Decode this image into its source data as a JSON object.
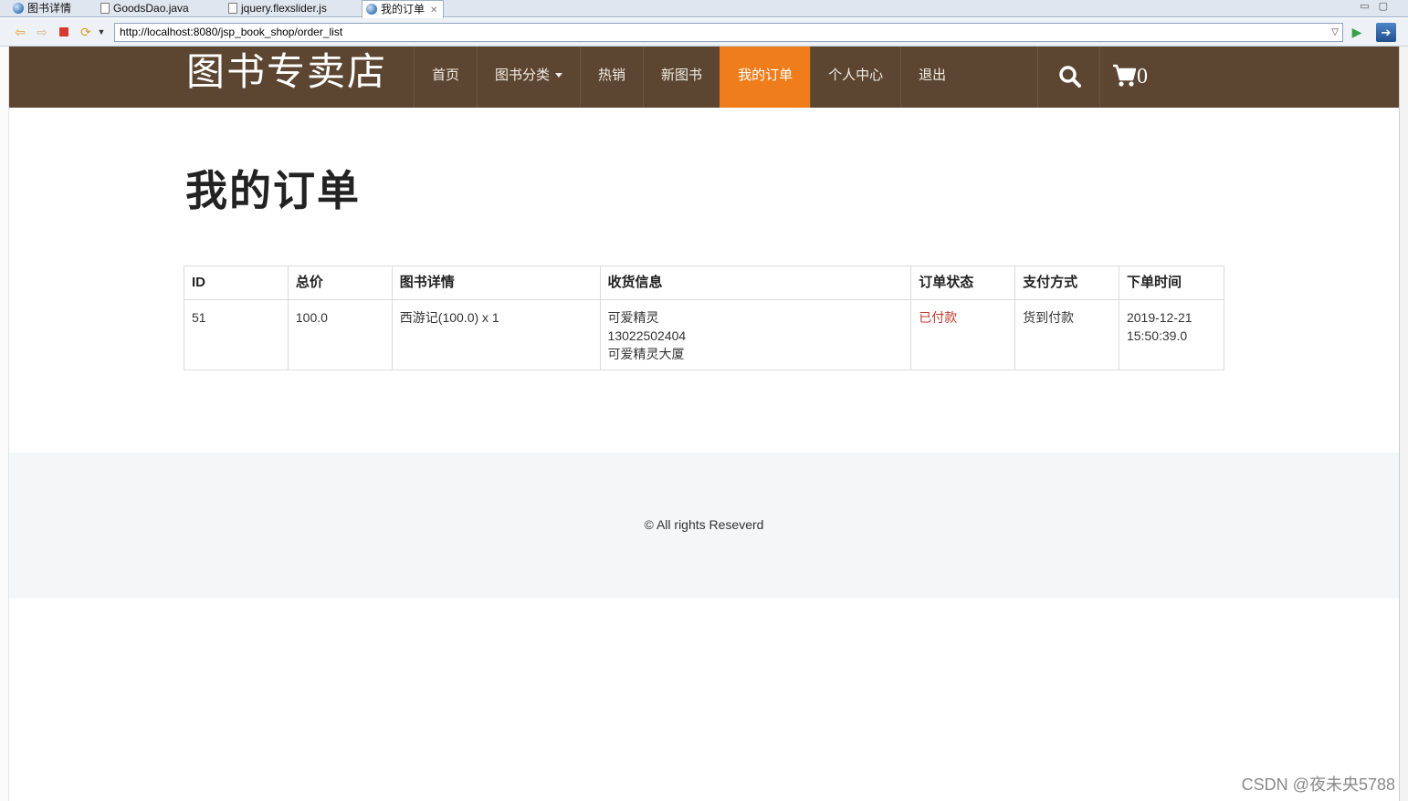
{
  "ide_tabs": [
    {
      "label": "图书详情",
      "icon": "globe-icon"
    },
    {
      "label": "GoodsDao.java",
      "icon": "java-file-icon"
    },
    {
      "label": "jquery.flexslider.js",
      "icon": "js-file-icon"
    },
    {
      "label": "我的订单",
      "icon": "globe-icon",
      "active": true
    }
  ],
  "browser": {
    "url": "http://localhost:8080/jsp_book_shop/order_list"
  },
  "site": {
    "brand": "图书专卖店",
    "nav": [
      "首页",
      "图书分类",
      "热销",
      "新图书",
      "我的订单",
      "个人中心",
      "退出"
    ],
    "active_nav": "我的订单",
    "cart_count": "0",
    "header_color": "#5c4631",
    "accent_color": "#ef7d1c"
  },
  "main": {
    "title": "我的订单",
    "table": {
      "headers": [
        "ID",
        "总价",
        "图书详情",
        "收货信息",
        "订单状态",
        "支付方式",
        "下单时间"
      ],
      "rows": [
        {
          "id": "51",
          "total": "100.0",
          "books": "西游记(100.0) x 1",
          "ship_name": "可爱精灵",
          "ship_phone": "13022502404",
          "ship_address": "可爱精灵大厦",
          "status": "已付款",
          "payment": "货到付款",
          "date": "2019-12-21",
          "time": "15:50:39.0"
        }
      ]
    }
  },
  "footer": {
    "text": "© All rights Reseverd"
  },
  "watermark": "CSDN @夜未央5788"
}
